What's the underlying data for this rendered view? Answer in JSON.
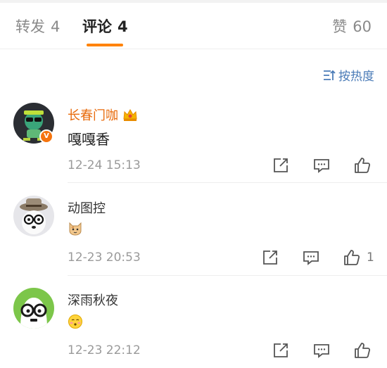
{
  "tabs": {
    "repost_label": "转发",
    "repost_count": "4",
    "comments_label": "评论",
    "comments_count": "4",
    "likes_label": "赞",
    "likes_count": "60"
  },
  "sort_label": "按热度",
  "accent_color": "#ff8200",
  "comments": [
    {
      "username": "长春门咖",
      "text": "嘎嘎香",
      "time": "12-24 15:13",
      "like_count": "",
      "verified": true
    },
    {
      "username": "动图控",
      "emoji": "cat-face-emoji",
      "time": "12-23 20:53",
      "like_count": "1"
    },
    {
      "username": "深雨秋夜",
      "emoji": "flushed-face-emoji",
      "time": "12-23 22:12",
      "like_count": ""
    }
  ]
}
